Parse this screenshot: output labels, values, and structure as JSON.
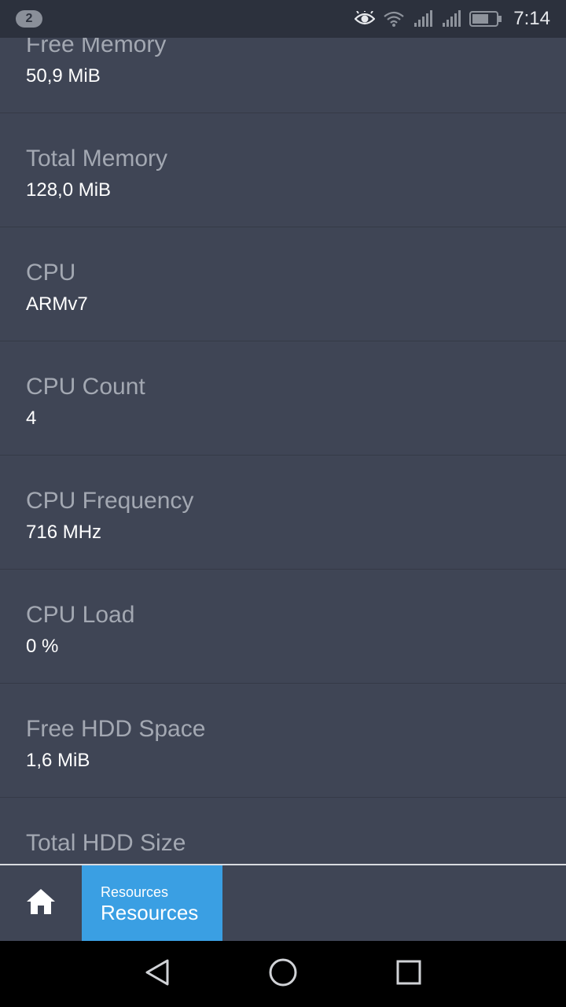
{
  "status_bar": {
    "notification_count": "2",
    "time": "7:14",
    "icons": [
      "eye-icon",
      "wifi-icon",
      "signal-icon",
      "signal-icon",
      "battery-icon"
    ]
  },
  "resources": [
    {
      "label": "Free Memory",
      "value": "50,9 MiB"
    },
    {
      "label": "Total Memory",
      "value": "128,0 MiB"
    },
    {
      "label": "CPU",
      "value": "ARMv7"
    },
    {
      "label": "CPU Count",
      "value": "4"
    },
    {
      "label": "CPU Frequency",
      "value": "716 MHz"
    },
    {
      "label": "CPU Load",
      "value": "0 %"
    },
    {
      "label": "Free HDD Space",
      "value": "1,6 MiB"
    },
    {
      "label": "Total HDD Size",
      "value": ""
    }
  ],
  "bottom_bar": {
    "home_icon": "home-icon",
    "tab_small_label": "Resources",
    "tab_large_label": "Resources",
    "active_color": "#3a9fe3"
  },
  "nav_bar": {
    "icons": [
      "back-icon",
      "home-circle-icon",
      "recents-icon"
    ]
  }
}
